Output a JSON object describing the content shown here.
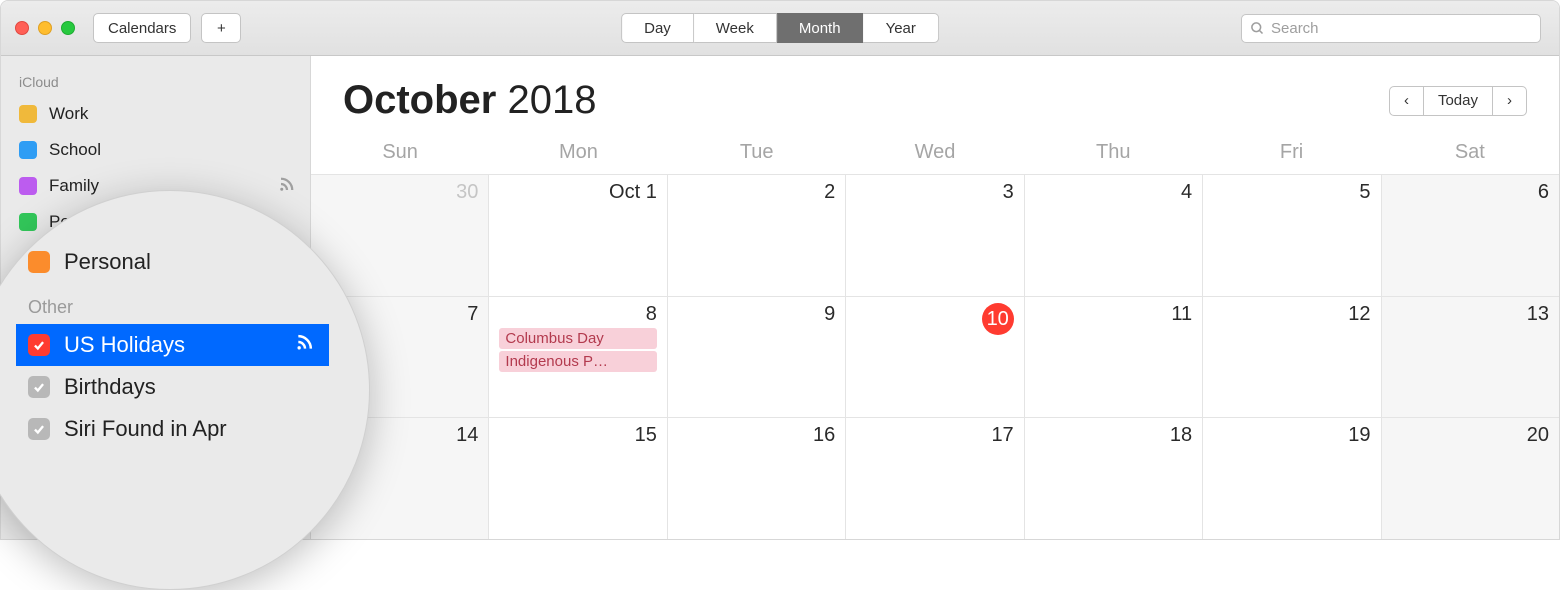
{
  "toolbar": {
    "calendars_label": "Calendars",
    "add_label": "+",
    "view": {
      "day": "Day",
      "week": "Week",
      "month": "Month",
      "year": "Year",
      "active": "Month"
    },
    "search_placeholder": "Search"
  },
  "sidebar": {
    "groups": [
      {
        "title": "iCloud",
        "items": [
          {
            "label": "Work",
            "color": "#f0b93b"
          },
          {
            "label": "School",
            "color": "#2f9df4"
          },
          {
            "label": "Family",
            "color": "#bc5cef",
            "shared": true
          },
          {
            "label": "Personal",
            "color": "#32c75a"
          }
        ]
      }
    ]
  },
  "magnify": {
    "personal_label": "Personal",
    "personal_color": "#fb8c2c",
    "group_title": "Other",
    "items": [
      {
        "label": "US Holidays",
        "color": "#ff3b30",
        "checked": true,
        "selected": true,
        "shared": true
      },
      {
        "label": "Birthdays",
        "color": "#b8b8b8",
        "checked": true
      },
      {
        "label": "Siri Found in Apr",
        "color": "#b8b8b8",
        "checked": true
      }
    ]
  },
  "header": {
    "month": "October",
    "year": "2018",
    "today_label": "Today"
  },
  "dow": [
    "Sun",
    "Mon",
    "Tue",
    "Wed",
    "Thu",
    "Fri",
    "Sat"
  ],
  "weeks": [
    {
      "cells": [
        {
          "label": "30",
          "gray": true,
          "weekend": true
        },
        {
          "label": "Oct 1"
        },
        {
          "label": "2"
        },
        {
          "label": "3"
        },
        {
          "label": "4"
        },
        {
          "label": "5"
        },
        {
          "label": "6",
          "weekend": true
        }
      ]
    },
    {
      "cells": [
        {
          "label": "7",
          "weekend": true
        },
        {
          "label": "8",
          "events": [
            "Columbus Day",
            "Indigenous P…"
          ]
        },
        {
          "label": "9"
        },
        {
          "label": "10",
          "today": true
        },
        {
          "label": "11"
        },
        {
          "label": "12"
        },
        {
          "label": "13",
          "weekend": true
        }
      ]
    },
    {
      "cells": [
        {
          "label": "14",
          "weekend": true
        },
        {
          "label": "15"
        },
        {
          "label": "16"
        },
        {
          "label": "17"
        },
        {
          "label": "18"
        },
        {
          "label": "19"
        },
        {
          "label": "20",
          "weekend": true
        }
      ]
    }
  ]
}
